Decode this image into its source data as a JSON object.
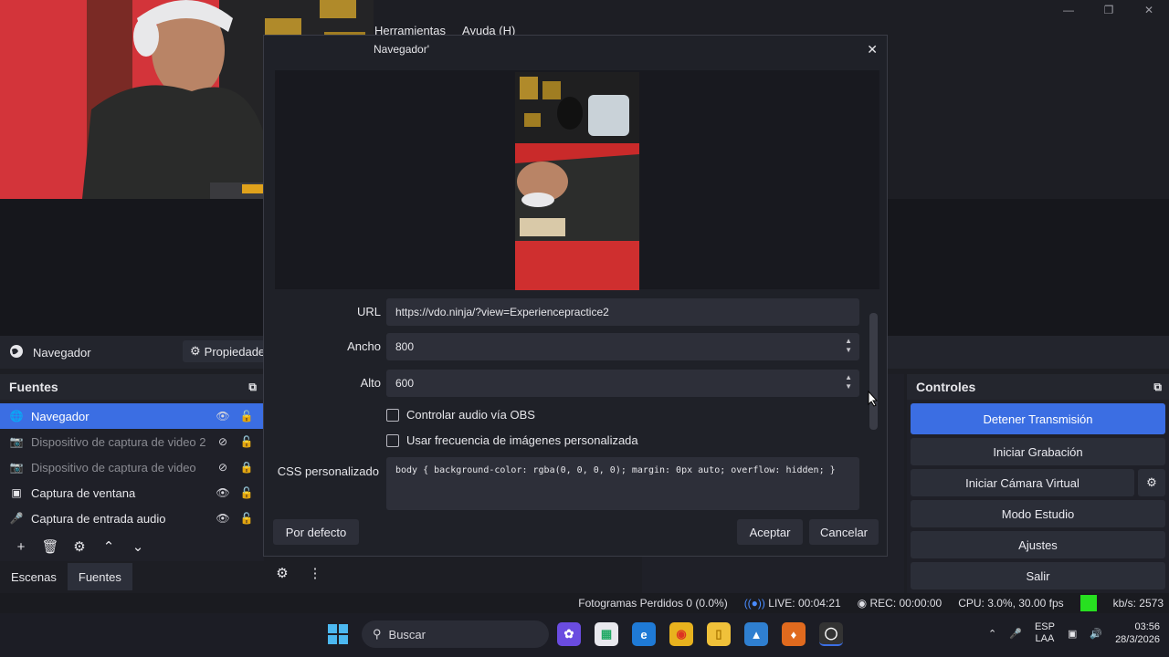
{
  "menubar": {
    "items": [
      "Herramientas",
      "Ayuda (H)"
    ]
  },
  "source_toolbar": {
    "source_name": "Navegador",
    "properties_label": "Propiedades"
  },
  "fuentes": {
    "title": "Fuentes",
    "items": [
      {
        "label": "Navegador",
        "icon": "globe-icon",
        "selected": true
      },
      {
        "label": "Dispositivo de captura de video 2",
        "icon": "camera-icon",
        "selected": false
      },
      {
        "label": "Dispositivo de captura de video",
        "icon": "camera-icon",
        "selected": false
      },
      {
        "label": "Captura de ventana",
        "icon": "window-icon",
        "selected": false
      },
      {
        "label": "Captura de entrada audio",
        "icon": "mic-icon",
        "selected": false
      }
    ]
  },
  "tabs": [
    "Escenas",
    "Fuentes"
  ],
  "controles": {
    "title": "Controles",
    "stop_stream": "Detener Transmisión",
    "start_recording": "Iniciar Grabación",
    "start_virtual_cam": "Iniciar Cámara Virtual",
    "studio_mode": "Modo Estudio",
    "settings": "Ajustes",
    "exit": "Salir"
  },
  "dialog": {
    "title": "Navegador'",
    "url_label": "URL",
    "url_value": "https://vdo.ninja/?view=Experiencepractice2",
    "width_label": "Ancho",
    "width_value": "800",
    "height_label": "Alto",
    "height_value": "600",
    "control_audio_label": "Controlar audio vía OBS",
    "custom_fps_label": "Usar frecuencia de imágenes personalizada",
    "css_label": "CSS personalizado",
    "css_value": "body { background-color: rgba(0, 0, 0, 0); margin: 0px auto; overflow: hidden; }",
    "defaults_button": "Por defecto",
    "accept_button": "Aceptar",
    "cancel_button": "Cancelar"
  },
  "statusbar": {
    "dropped_frames": "Fotogramas Perdidos 0 (0.0%)",
    "live": "LIVE: 00:04:21",
    "rec": "REC: 00:00:00",
    "cpu": "CPU: 3.0%, 30.00 fps",
    "kbs": "kb/s: 2573"
  },
  "taskbar": {
    "search_placeholder": "Buscar",
    "lang_line1": "ESP",
    "lang_line2": "LAA",
    "time": "03:56",
    "date": "28/3/2026"
  },
  "colors": {
    "accent": "#3b6ee3",
    "status_green": "#27e020"
  }
}
